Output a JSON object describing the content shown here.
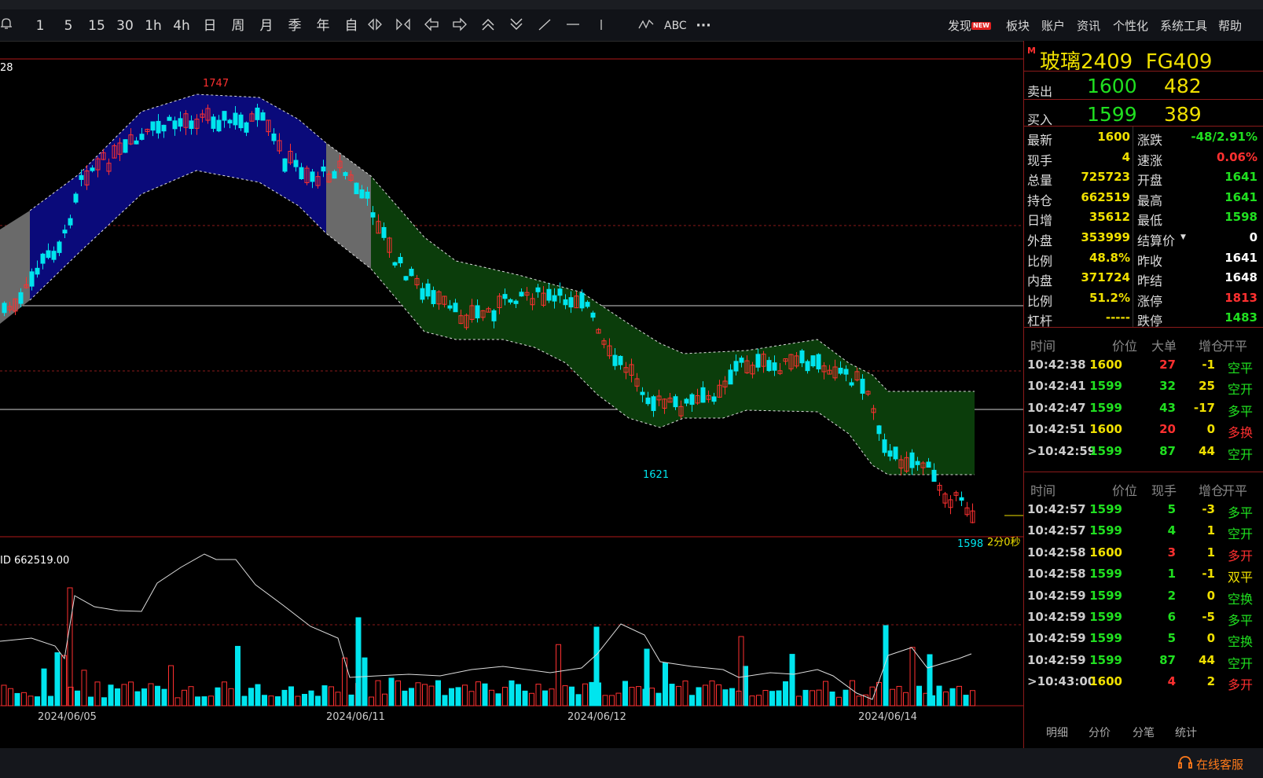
{
  "toolbar": {
    "periods": [
      "1",
      "5",
      "15",
      "30",
      "1h",
      "4h",
      "日",
      "周",
      "月",
      "季",
      "年",
      "自"
    ],
    "text_tool": "ABC",
    "more": "···",
    "menu": [
      {
        "label": "发现",
        "badge": "NEW"
      },
      {
        "label": "板块"
      },
      {
        "label": "账户"
      },
      {
        "label": "资讯"
      },
      {
        "label": "个性化"
      },
      {
        "label": "系统工具"
      },
      {
        "label": "帮助"
      }
    ]
  },
  "chart": {
    "top_left_label": "28",
    "high_label": "1747",
    "low_label": "1621",
    "last_label": "1598",
    "countdown": "2分0秒",
    "indicator_label": "ID 662519.00",
    "dates": [
      "2024/06/05",
      "2024/06/11",
      "2024/06/12",
      "2024/06/14"
    ]
  },
  "panel": {
    "marker": "M",
    "title": "玻璃2409",
    "code": "FG409",
    "sell": {
      "label": "卖出",
      "price": "1600",
      "volume": "482"
    },
    "buy": {
      "label": "买入",
      "price": "1599",
      "volume": "389"
    },
    "quote": [
      {
        "l": "最新",
        "v": "1600",
        "c": "#f0e000",
        "l2": "涨跌",
        "v2": "-48/2.91%",
        "c2": "#20e020"
      },
      {
        "l": "现手",
        "v": "4",
        "c": "#f0e000",
        "l2": "速涨",
        "v2": "0.06%",
        "c2": "#ff3030"
      },
      {
        "l": "总量",
        "v": "725723",
        "c": "#f0e000",
        "l2": "开盘",
        "v2": "1641",
        "c2": "#20e020"
      },
      {
        "l": "持仓",
        "v": "662519",
        "c": "#f0e000",
        "l2": "最高",
        "v2": "1641",
        "c2": "#20e020"
      },
      {
        "l": "日增",
        "v": "35612",
        "c": "#f0e000",
        "l2": "最低",
        "v2": "1598",
        "c2": "#20e020"
      },
      {
        "l": "外盘",
        "v": "353999",
        "c": "#f0e000",
        "l2": "结算价",
        "v2": "0",
        "c2": "#ffffff"
      },
      {
        "l": "比例",
        "v": "48.8%",
        "c": "#f0e000",
        "l2": "昨收",
        "v2": "1641",
        "c2": "#ffffff"
      },
      {
        "l": "内盘",
        "v": "371724",
        "c": "#f0e000",
        "l2": "昨结",
        "v2": "1648",
        "c2": "#ffffff"
      },
      {
        "l": "比例",
        "v": "51.2%",
        "c": "#f0e000",
        "l2": "涨停",
        "v2": "1813",
        "c2": "#ff3030"
      },
      {
        "l": "杠杆",
        "v": "-----",
        "c": "#f0e000",
        "l2": "跌停",
        "v2": "1483",
        "c2": "#20e020"
      }
    ],
    "big_headers": [
      "时间",
      "价位",
      "大单",
      "增仓",
      "开平"
    ],
    "big_orders": [
      {
        "t": "10:42:38",
        "p": "1600",
        "p_c": "#f0e000",
        "v": "27",
        "v_c": "#ff3030",
        "d": "-1",
        "kp": "空平",
        "kp_c": "#20e020"
      },
      {
        "t": "10:42:41",
        "p": "1599",
        "p_c": "#20e020",
        "v": "32",
        "v_c": "#20e020",
        "d": "25",
        "kp": "空开",
        "kp_c": "#20e020"
      },
      {
        "t": "10:42:47",
        "p": "1599",
        "p_c": "#20e020",
        "v": "43",
        "v_c": "#20e020",
        "d": "-17",
        "kp": "多平",
        "kp_c": "#20e020"
      },
      {
        "t": "10:42:51",
        "p": "1600",
        "p_c": "#f0e000",
        "v": "20",
        "v_c": "#ff3030",
        "d": "0",
        "kp": "多换",
        "kp_c": "#ff3030"
      },
      {
        "t": ">10:42:59",
        "p": "1599",
        "p_c": "#20e020",
        "v": "87",
        "v_c": "#20e020",
        "d": "44",
        "kp": "空开",
        "kp_c": "#20e020"
      }
    ],
    "tick_headers": [
      "时间",
      "价位",
      "现手",
      "增仓",
      "开平"
    ],
    "ticks": [
      {
        "t": "10:42:57",
        "p": "1599",
        "p_c": "#20e020",
        "v": "5",
        "v_c": "#20e020",
        "d": "-3",
        "kp": "多平",
        "kp_c": "#20e020"
      },
      {
        "t": "10:42:57",
        "p": "1599",
        "p_c": "#20e020",
        "v": "4",
        "v_c": "#20e020",
        "d": "1",
        "kp": "空开",
        "kp_c": "#20e020"
      },
      {
        "t": "10:42:58",
        "p": "1600",
        "p_c": "#f0e000",
        "v": "3",
        "v_c": "#ff3030",
        "d": "1",
        "kp": "多开",
        "kp_c": "#ff3030"
      },
      {
        "t": "10:42:58",
        "p": "1599",
        "p_c": "#20e020",
        "v": "1",
        "v_c": "#20e020",
        "d": "-1",
        "kp": "双平",
        "kp_c": "#f0e000"
      },
      {
        "t": "10:42:59",
        "p": "1599",
        "p_c": "#20e020",
        "v": "2",
        "v_c": "#20e020",
        "d": "0",
        "kp": "空换",
        "kp_c": "#20e020"
      },
      {
        "t": "10:42:59",
        "p": "1599",
        "p_c": "#20e020",
        "v": "6",
        "v_c": "#20e020",
        "d": "-5",
        "kp": "多平",
        "kp_c": "#20e020"
      },
      {
        "t": "10:42:59",
        "p": "1599",
        "p_c": "#20e020",
        "v": "5",
        "v_c": "#20e020",
        "d": "0",
        "kp": "空换",
        "kp_c": "#20e020"
      },
      {
        "t": "10:42:59",
        "p": "1599",
        "p_c": "#20e020",
        "v": "87",
        "v_c": "#20e020",
        "d": "44",
        "kp": "空开",
        "kp_c": "#20e020"
      },
      {
        "t": ">10:43:00",
        "p": "1600",
        "p_c": "#f0e000",
        "v": "4",
        "v_c": "#ff3030",
        "d": "2",
        "kp": "多开",
        "kp_c": "#ff3030"
      }
    ],
    "tabs": [
      "明细",
      "分价",
      "分笔",
      "统计"
    ]
  },
  "bottom": {
    "service": "在线客服"
  },
  "colors": {
    "up": "#ff3030",
    "down": "#00e5ee",
    "green": "#20e020",
    "yellow": "#f0e000"
  }
}
